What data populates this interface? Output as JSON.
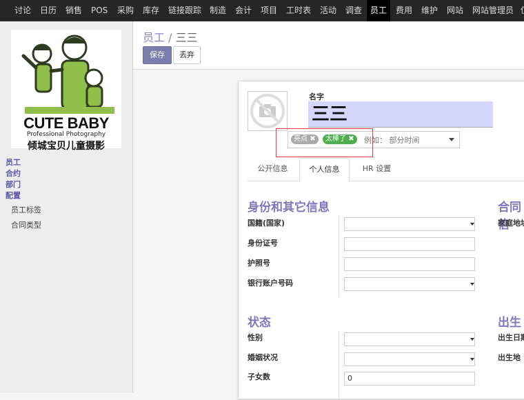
{
  "topbar": {
    "items": [
      "讨论",
      "日历",
      "销售",
      "POS",
      "采购",
      "库存",
      "链接跟踪",
      "制造",
      "会计",
      "项目",
      "工时表",
      "活动",
      "调查",
      "员工",
      "费用",
      "维护",
      "网站",
      "网站管理员",
      "仪"
    ],
    "active_index": 13
  },
  "sidebar": {
    "logo": {
      "line1": "CUTE BABY",
      "line2": "Professional Photography",
      "line3": "倾城宝贝儿童摄影"
    },
    "menu": [
      "员工",
      "合约",
      "部门",
      "配置"
    ],
    "submenu": [
      "员工标签",
      "合同类型"
    ]
  },
  "control_panel": {
    "breadcrumb_parent": "员工",
    "breadcrumb_sep": "/",
    "breadcrumb_current": "三三",
    "save_label": "保存",
    "discard_label": "丢弃"
  },
  "form": {
    "name_label": "名字",
    "name_value": "三三",
    "tags": [
      {
        "label": "亮点",
        "color": "#aaaaaa"
      },
      {
        "label": "太棒了",
        "color": "#4cae4c"
      }
    ],
    "tags_placeholder": "例如： 部分时间",
    "tabs": [
      "公开信息",
      "个人信息",
      "HR 设置"
    ],
    "active_tab": 1,
    "section1_title": "身份和其它信息",
    "section1_fields": [
      {
        "label": "国籍(国家)",
        "value": "",
        "type": "select"
      },
      {
        "label": "身份证号",
        "value": "",
        "type": "text"
      },
      {
        "label": "护照号",
        "value": "",
        "type": "text"
      },
      {
        "label": "银行账户号码",
        "value": "",
        "type": "select"
      }
    ],
    "section2_title": "状态",
    "section2_fields": [
      {
        "label": "性别",
        "value": "",
        "type": "select"
      },
      {
        "label": "婚姻状况",
        "value": "",
        "type": "select"
      },
      {
        "label": "子女数",
        "value": "0",
        "type": "text"
      }
    ],
    "right_section1_title": "合同信",
    "right_section1_field": "家庭地址",
    "right_section2_title": "出生",
    "right_section2_fields": [
      "出生日期",
      "出生地"
    ]
  }
}
